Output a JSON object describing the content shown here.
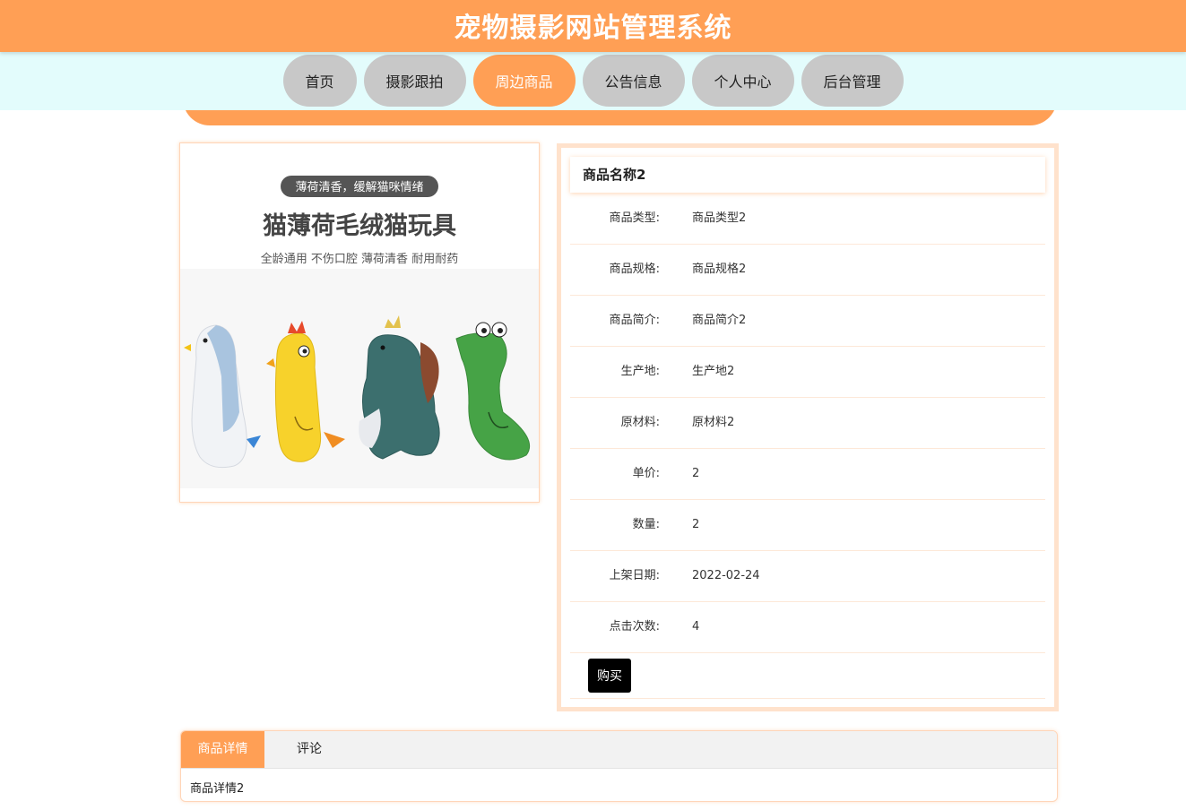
{
  "header": {
    "title": "宠物摄影网站管理系统"
  },
  "nav": {
    "items": [
      {
        "label": "首页"
      },
      {
        "label": "摄影跟拍"
      },
      {
        "label": "周边商品"
      },
      {
        "label": "公告信息"
      },
      {
        "label": "个人中心"
      },
      {
        "label": "后台管理"
      }
    ],
    "active": "周边商品"
  },
  "product_image": {
    "badge": "薄荷清香，缓解猫咪情绪",
    "title": "猫薄荷毛绒猫玩具",
    "subtitle": "全龄通用 不伤口腔 薄荷清香 耐用耐药"
  },
  "product": {
    "name": "商品名称2",
    "fields": [
      {
        "label": "商品类型:",
        "value": "商品类型2"
      },
      {
        "label": "商品规格:",
        "value": "商品规格2"
      },
      {
        "label": "商品简介:",
        "value": "商品简介2"
      },
      {
        "label": "生产地:",
        "value": "生产地2"
      },
      {
        "label": "原材料:",
        "value": "原材料2"
      },
      {
        "label": "单价:",
        "value": "2"
      },
      {
        "label": "数量:",
        "value": "2"
      },
      {
        "label": "上架日期:",
        "value": "2022-02-24"
      },
      {
        "label": "点击次数:",
        "value": "4"
      }
    ],
    "buy_label": "购买"
  },
  "tabs": {
    "items": [
      {
        "label": "商品详情"
      },
      {
        "label": "评论"
      }
    ],
    "active": "商品详情",
    "content": "商品详情2"
  },
  "colors": {
    "accent": "#ff9f55",
    "nav_band": "#e3fcfc",
    "nav_button": "#c8c8c8"
  }
}
